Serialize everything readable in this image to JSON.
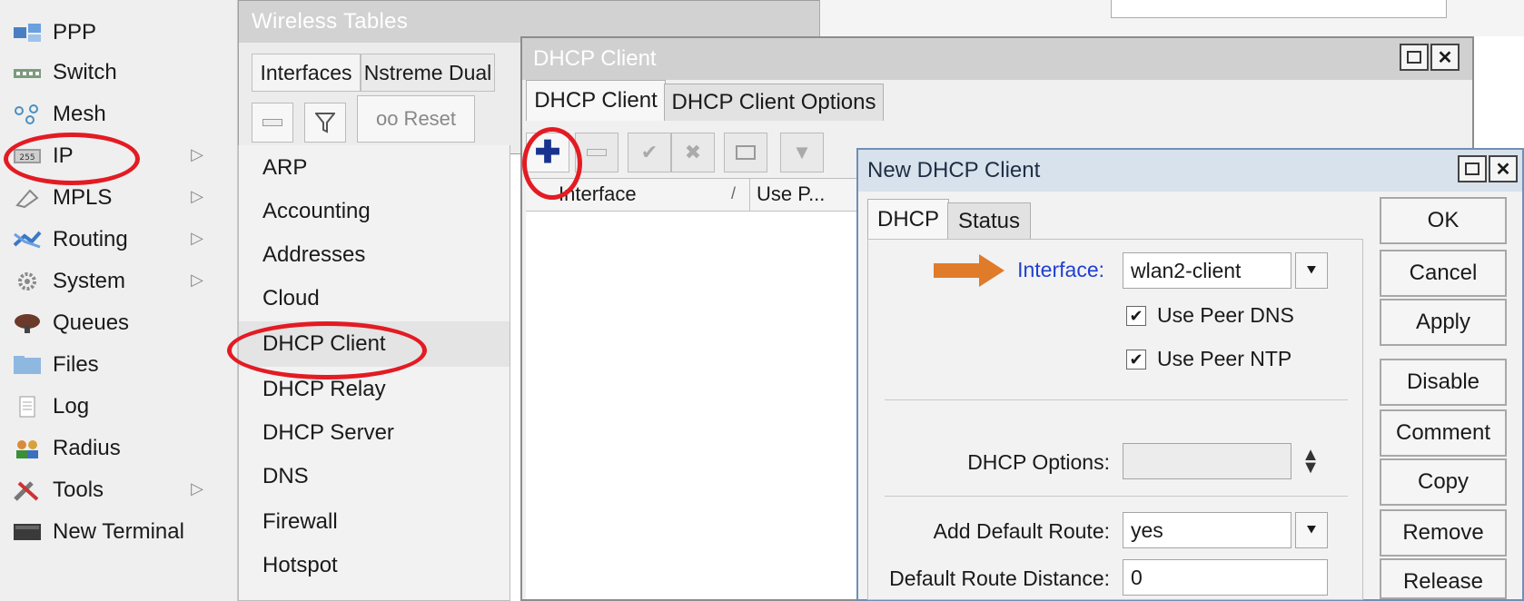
{
  "left_menu": {
    "items": [
      {
        "label": "PPP",
        "icon": "ppp-icon",
        "arrow": false
      },
      {
        "label": "Switch",
        "icon": "switch-icon",
        "arrow": false
      },
      {
        "label": "Mesh",
        "icon": "mesh-icon",
        "arrow": false
      },
      {
        "label": "IP",
        "icon": "ip-icon",
        "arrow": true
      },
      {
        "label": "MPLS",
        "icon": "mpls-icon",
        "arrow": true
      },
      {
        "label": "Routing",
        "icon": "routing-icon",
        "arrow": true
      },
      {
        "label": "System",
        "icon": "gear-icon",
        "arrow": true
      },
      {
        "label": "Queues",
        "icon": "queues-icon",
        "arrow": false
      },
      {
        "label": "Files",
        "icon": "folder-icon",
        "arrow": false
      },
      {
        "label": "Log",
        "icon": "log-icon",
        "arrow": false
      },
      {
        "label": "Radius",
        "icon": "users-icon",
        "arrow": false
      },
      {
        "label": "Tools",
        "icon": "tools-icon",
        "arrow": true
      },
      {
        "label": "New Terminal",
        "icon": "terminal-icon",
        "arrow": false
      }
    ],
    "arrow_glyph": "▷"
  },
  "sub_menu": {
    "items": [
      "ARP",
      "Accounting",
      "Addresses",
      "Cloud",
      "DHCP Client",
      "DHCP Relay",
      "DHCP Server",
      "DNS",
      "Firewall",
      "Hotspot"
    ]
  },
  "wireless_window": {
    "title": "Wireless Tables",
    "tabs": [
      "Interfaces",
      "Nstreme Dual"
    ],
    "reset_label": "oo Reset"
  },
  "dhcp_window": {
    "title": "DHCP Client",
    "tabs": [
      "DHCP Client",
      "DHCP Client Options"
    ],
    "columns": [
      "Interface",
      "Use P..."
    ],
    "sort_glyph": "/"
  },
  "new_dialog": {
    "title": "New DHCP Client",
    "tabs": [
      "DHCP",
      "Status"
    ],
    "interface_label": "Interface:",
    "interface_value": "wlan2-client",
    "use_peer_dns": "Use Peer DNS",
    "use_peer_ntp": "Use Peer NTP",
    "check_glyph": "✔",
    "dhcp_options_label": "DHCP Options:",
    "dhcp_options_value": "",
    "add_default_route_label": "Add Default Route:",
    "add_default_route_value": "yes",
    "default_route_distance_label": "Default Route Distance:",
    "default_route_distance_value": "0",
    "buttons": [
      "OK",
      "Cancel",
      "Apply",
      "Disable",
      "Comment",
      "Copy",
      "Remove",
      "Release"
    ]
  },
  "colors": {
    "highlight_ring": "#e31b23",
    "arrow": "#e07b2a",
    "interface_label": "#1f3fd1",
    "add_button": "#17338f"
  }
}
